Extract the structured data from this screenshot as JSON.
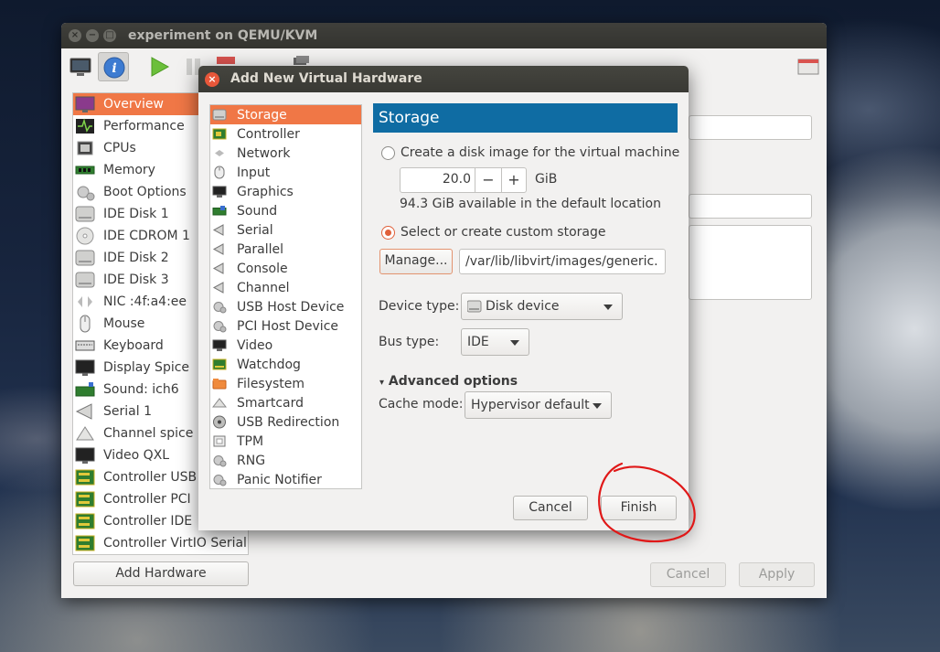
{
  "main_window": {
    "title": "experiment on QEMU/KVM",
    "hardware_list": [
      {
        "label": "Overview",
        "icon": "overview-monitor-icon",
        "selected": true
      },
      {
        "label": "Performance",
        "icon": "performance-graph-icon"
      },
      {
        "label": "CPUs",
        "icon": "cpu-chip-icon"
      },
      {
        "label": "Memory",
        "icon": "memory-module-icon"
      },
      {
        "label": "Boot Options",
        "icon": "boot-gear-icon"
      },
      {
        "label": "IDE Disk 1",
        "icon": "disk-icon"
      },
      {
        "label": "IDE CDROM 1",
        "icon": "cdrom-icon"
      },
      {
        "label": "IDE Disk 2",
        "icon": "disk-icon"
      },
      {
        "label": "IDE Disk 3",
        "icon": "disk-icon"
      },
      {
        "label": "NIC :4f:a4:ee",
        "icon": "network-arrows-icon"
      },
      {
        "label": "Mouse",
        "icon": "mouse-icon"
      },
      {
        "label": "Keyboard",
        "icon": "keyboard-icon"
      },
      {
        "label": "Display Spice",
        "icon": "display-icon"
      },
      {
        "label": "Sound: ich6",
        "icon": "sound-card-icon"
      },
      {
        "label": "Serial 1",
        "icon": "serial-port-icon"
      },
      {
        "label": "Channel spice",
        "icon": "channel-icon"
      },
      {
        "label": "Video QXL",
        "icon": "video-card-icon"
      },
      {
        "label": "Controller USB",
        "icon": "controller-card-icon"
      },
      {
        "label": "Controller PCI",
        "icon": "controller-card-icon"
      },
      {
        "label": "Controller IDE",
        "icon": "controller-card-icon"
      },
      {
        "label": "Controller VirtIO Serial",
        "icon": "controller-card-icon"
      }
    ],
    "add_hardware_label": "Add Hardware",
    "cancel_label": "Cancel",
    "apply_label": "Apply"
  },
  "dialog": {
    "title": "Add New Virtual Hardware",
    "categories": [
      {
        "label": "Storage",
        "icon": "storage-disk-icon",
        "selected": true
      },
      {
        "label": "Controller",
        "icon": "controller-card-icon"
      },
      {
        "label": "Network",
        "icon": "network-arrows-icon"
      },
      {
        "label": "Input",
        "icon": "mouse-icon"
      },
      {
        "label": "Graphics",
        "icon": "display-icon"
      },
      {
        "label": "Sound",
        "icon": "sound-card-icon"
      },
      {
        "label": "Serial",
        "icon": "serial-port-icon"
      },
      {
        "label": "Parallel",
        "icon": "parallel-port-icon"
      },
      {
        "label": "Console",
        "icon": "console-port-icon"
      },
      {
        "label": "Channel",
        "icon": "channel-port-icon"
      },
      {
        "label": "USB Host Device",
        "icon": "usb-gear-icon"
      },
      {
        "label": "PCI Host Device",
        "icon": "pci-gear-icon"
      },
      {
        "label": "Video",
        "icon": "video-monitor-icon"
      },
      {
        "label": "Watchdog",
        "icon": "watchdog-card-icon"
      },
      {
        "label": "Filesystem",
        "icon": "folder-icon"
      },
      {
        "label": "Smartcard",
        "icon": "smartcard-reader-icon"
      },
      {
        "label": "USB Redirection",
        "icon": "usb-redirection-icon"
      },
      {
        "label": "TPM",
        "icon": "tpm-chip-icon"
      },
      {
        "label": "RNG",
        "icon": "rng-gear-icon"
      },
      {
        "label": "Panic Notifier",
        "icon": "panic-gear-icon"
      }
    ],
    "panel_title": "Storage",
    "create_disk_label": "Create a disk image for the virtual machine",
    "create_disk_selected": false,
    "size_value": "20.0",
    "size_unit": "GiB",
    "available_text": "94.3 GiB available in the default location",
    "custom_storage_label": "Select or create custom storage",
    "custom_storage_selected": true,
    "manage_label": "Manage...",
    "path_value": "/var/lib/libvirt/images/generic.",
    "device_type_label": "Device type:",
    "device_type_value": "Disk device",
    "bus_type_label": "Bus type:",
    "bus_type_value": "IDE",
    "advanced_label": "Advanced options",
    "cache_mode_label": "Cache mode:",
    "cache_mode_value": "Hypervisor default",
    "cancel_label": "Cancel",
    "finish_label": "Finish"
  },
  "annotation": {
    "shape": "red hand-drawn circle around Finish button",
    "color": "#e01818"
  },
  "colors": {
    "accent": "#f07746",
    "panel_title": "#0f6ca3",
    "titlebar": "#3c3c37"
  }
}
